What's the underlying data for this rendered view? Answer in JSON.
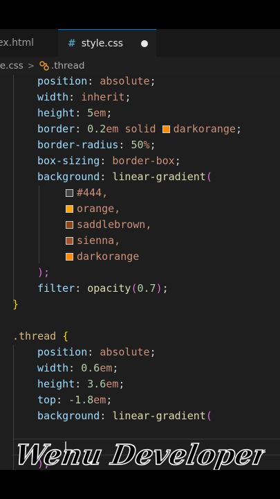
{
  "tabs": [
    {
      "label": "ex.html"
    },
    {
      "label": "style.css",
      "icon": "#"
    }
  ],
  "breadcrumb": {
    "file": "le.css",
    "separator": ">",
    "symbol": ".thread"
  },
  "watermark": "Wenu Developer",
  "colors": {
    "orange": "#ffa500",
    "darkorange": "#ff8c00",
    "saddlebrown": "#8b4513",
    "sienna": "#a0522d",
    "c444": "#444444"
  },
  "code": {
    "l1": {
      "prop": "position",
      "val": "absolute"
    },
    "l2": {
      "prop": "width",
      "val": "inherit"
    },
    "l3": {
      "prop": "height",
      "num": "5",
      "unit": "em"
    },
    "l4": {
      "prop": "border",
      "num": "0.2",
      "unit": "em",
      "val1": "solid",
      "val2": "darkorange"
    },
    "l5": {
      "prop": "border-radius",
      "num": "50",
      "unit": "%"
    },
    "l6": {
      "prop": "box-sizing",
      "val": "border-box"
    },
    "l7": {
      "prop": "background",
      "fn": "linear-gradient"
    },
    "g1": "#444,",
    "g2": "orange,",
    "g3": "saddlebrown,",
    "g4": "sienna,",
    "g5": "darkorange",
    "l13": ");",
    "l14": {
      "prop": "filter",
      "fn": "opacity",
      "num": "0.7"
    },
    "l15": "}",
    "sel": ".thread",
    "l18": {
      "prop": "position",
      "val": "absolute"
    },
    "l19": {
      "prop": "width",
      "num": "0.6",
      "unit": "em"
    },
    "l20": {
      "prop": "height",
      "num": "3.6",
      "unit": "em"
    },
    "l21": {
      "prop": "top",
      "num": "-1.8",
      "unit": "em"
    },
    "l22": {
      "prop": "background",
      "fn": "linear-gradient"
    },
    "l24": ");"
  }
}
